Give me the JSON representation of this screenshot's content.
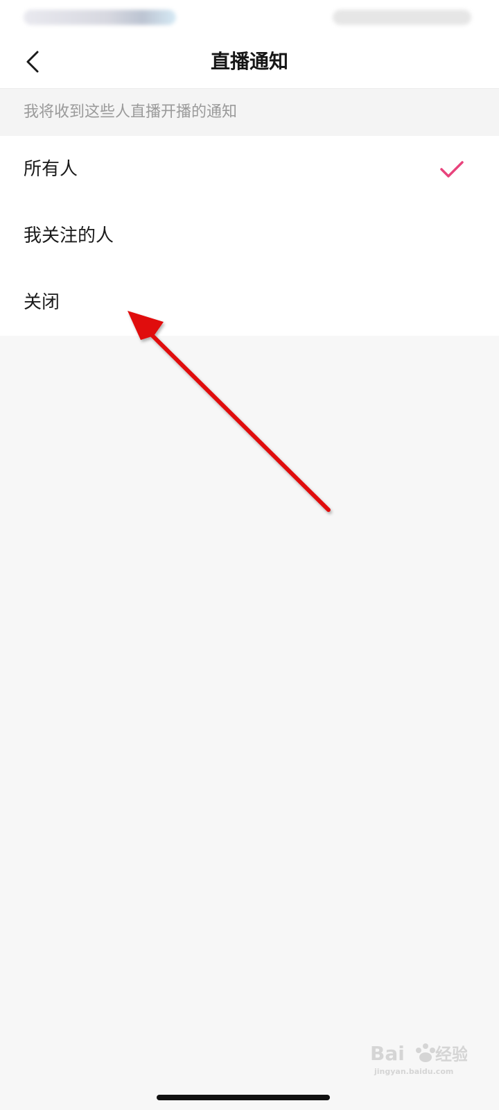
{
  "header": {
    "title": "直播通知"
  },
  "section": {
    "caption": "我将收到这些人直播开播的通知"
  },
  "options": [
    {
      "label": "所有人",
      "selected": true
    },
    {
      "label": "我关注的人",
      "selected": false
    },
    {
      "label": "关闭",
      "selected": false
    }
  ],
  "colors": {
    "accent": "#e8437c",
    "annotation_arrow": "#e00b0b"
  },
  "icons": {
    "back": "chevron-left-icon",
    "check": "check-icon"
  },
  "watermark": {
    "text": "Bai经验",
    "subtext": "jingyan.baidu.com"
  }
}
